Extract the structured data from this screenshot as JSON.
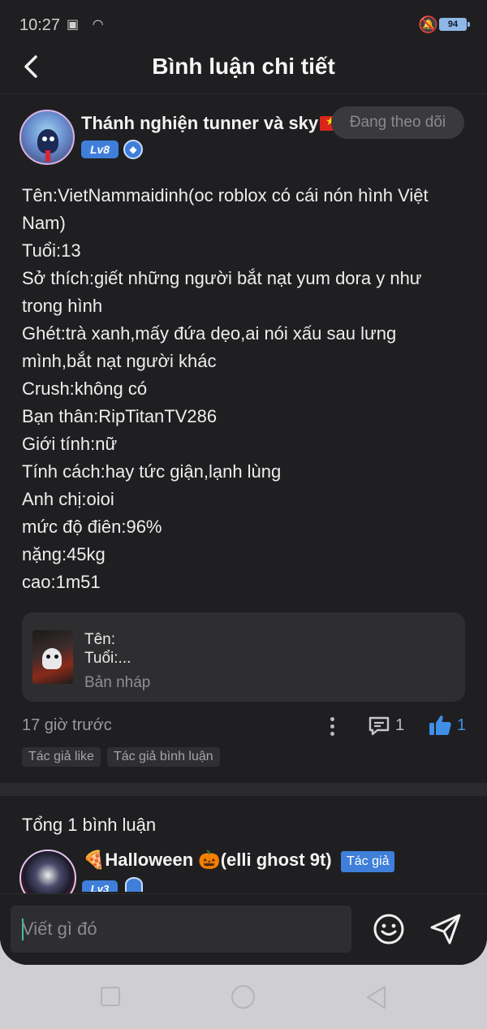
{
  "status_bar": {
    "time": "10:27",
    "battery": "94"
  },
  "header": {
    "title": "Bình luận chi tiết"
  },
  "post": {
    "author": {
      "name": "Thánh nghiện tunner và sky",
      "level": "Lv8"
    },
    "follow_label": "Đang theo dõi",
    "content_lines": [
      "Tên:VietNammaidinh(oc roblox có cái nón hình Việt",
      "Nam)",
      "Tuổi:13",
      "Sở thích:giết những người bắt nạt yum dora y như",
      "trong hình",
      "Ghét:trà xanh,mấy đứa dẹo,ai nói xấu sau lưng",
      "mình,bắt nạt người khác",
      "Crush:không có",
      "Bạn thân:RipTitanTV286",
      "Giới tính:nữ",
      "Tính cách:hay tức giận,lạnh lùng",
      "Anh chị:oioi",
      "mức độ điên:96%",
      "nặng:45kg",
      "cao:1m51"
    ],
    "draft": {
      "line1": "Tên:",
      "line2": "Tuổi:...",
      "label": "Bản nháp"
    },
    "time_ago": "17 giờ trước",
    "comment_count": "1",
    "like_count": "1",
    "tags": [
      "Tác giả like",
      "Tác giả bình luận"
    ]
  },
  "comments": {
    "total_label": "Tổng 1 bình luận",
    "items": [
      {
        "name": "🍕Halloween 🎃(elli ghost 9t)",
        "author_tag": "Tác giả",
        "level": "Lv3"
      }
    ]
  },
  "input": {
    "placeholder": "Viết gì đó"
  },
  "colors": {
    "background": "#1f1f21",
    "accent": "#3f7fd9",
    "like": "#3f8fe6"
  },
  "icons": [
    "back-arrow-icon",
    "shield-icon",
    "more-vertical-icon",
    "comment-icon",
    "thumbs-up-icon",
    "emoji-icon",
    "send-icon"
  ]
}
